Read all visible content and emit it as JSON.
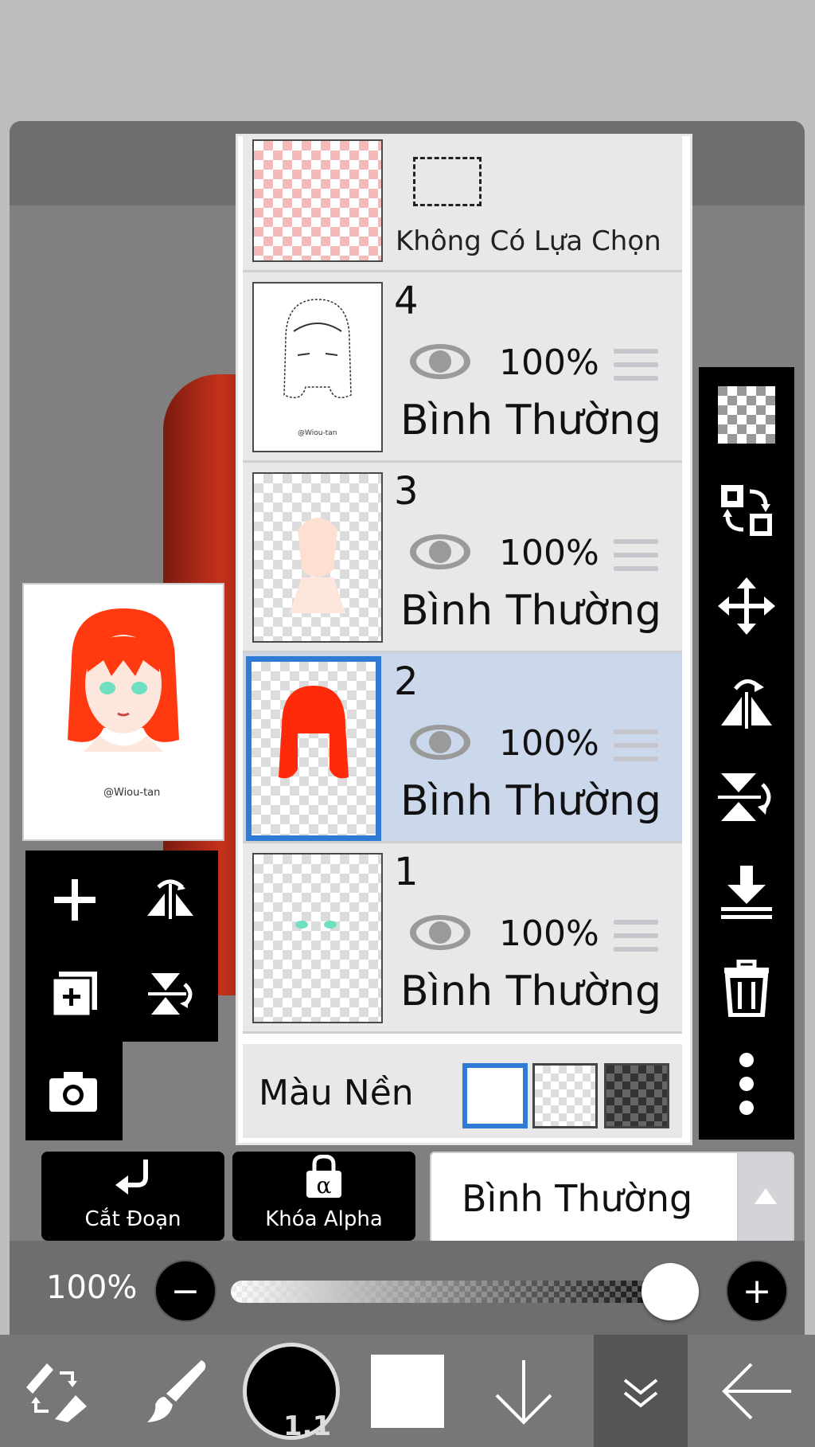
{
  "layers_panel": {
    "selection_layer": {
      "label": "Không Có Lựa Chọn"
    },
    "layers": [
      {
        "name": "4",
        "opacity": "100%",
        "blend": "Bình Thường",
        "visible": true,
        "selected": false
      },
      {
        "name": "3",
        "opacity": "100%",
        "blend": "Bình Thường",
        "visible": true,
        "selected": false
      },
      {
        "name": "2",
        "opacity": "100%",
        "blend": "Bình Thường",
        "visible": true,
        "selected": true
      },
      {
        "name": "1",
        "opacity": "100%",
        "blend": "Bình Thường",
        "visible": true,
        "selected": false
      }
    ],
    "background": {
      "label": "Màu Nền",
      "options": [
        "white",
        "transparent",
        "dark-checker"
      ],
      "selected": "white"
    }
  },
  "layer_buttons": {
    "clipping": "Cắt Đoạn",
    "alpha_lock": "Khóa Alpha",
    "alpha_symbol": "α",
    "blend_mode": "Bình Thường"
  },
  "opacity_control": {
    "label": "100%",
    "value": 1.0,
    "minus": "−",
    "plus": "+"
  },
  "brush": {
    "size": "1.1"
  },
  "colors": {
    "accent": "#2f7bd6",
    "selected_row": "#cbd7ea",
    "toolbar": "#000000"
  }
}
